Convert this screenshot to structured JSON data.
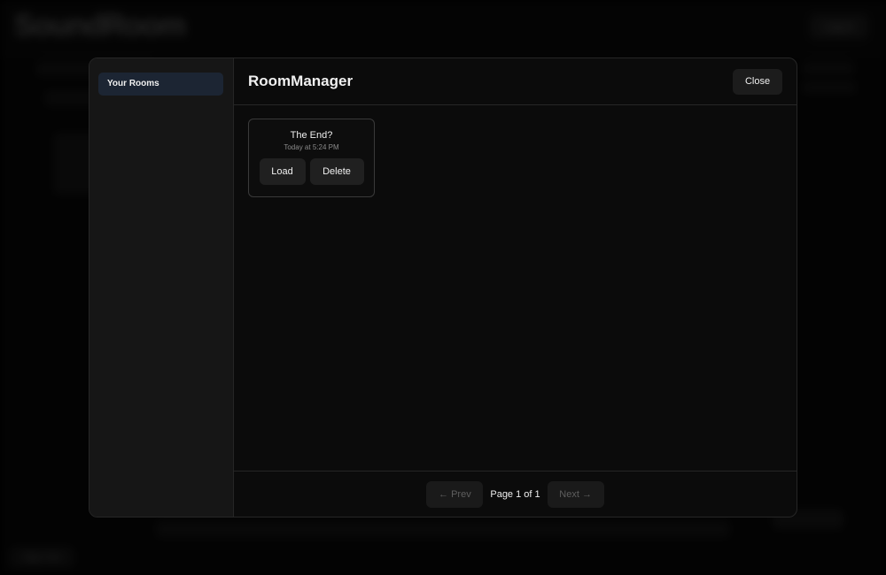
{
  "background": {
    "app_name": "SoundRoom",
    "login_label": "Log in",
    "bottom_left_label": "Sign Out"
  },
  "modal": {
    "title": "RoomManager",
    "close_label": "Close",
    "sidebar": {
      "items": [
        {
          "label": "Your Rooms",
          "active": true
        }
      ]
    },
    "rooms": [
      {
        "name": "The End?",
        "timestamp": "Today at 5:24 PM",
        "load_label": "Load",
        "delete_label": "Delete"
      }
    ],
    "pagination": {
      "prev_label": "← Prev",
      "next_label": "Next →",
      "indicator": "Page 1 of 1"
    }
  },
  "colors": {
    "modal_bg": "#0b0b0b",
    "sidebar_bg": "#161616",
    "active_item_bg": "#1c2533",
    "button_bg": "#1c1c1c"
  }
}
